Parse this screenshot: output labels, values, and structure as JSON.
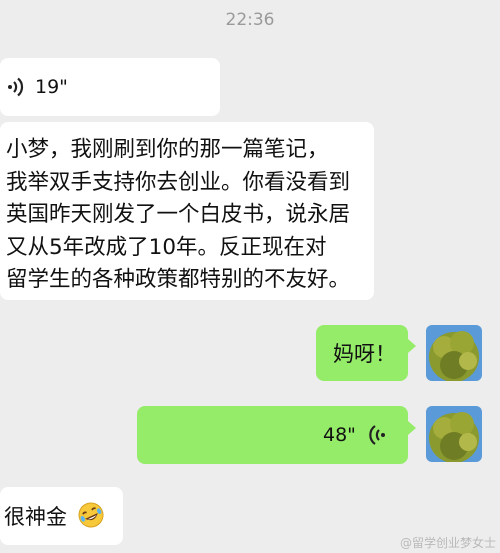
{
  "timestamp": "22:36",
  "messages": {
    "voice_in_duration": "19\"",
    "text_in_lines": "小梦，我刚刷到你的那一篇笔记，\n我举双手支持你去创业。你看没看到\n英国昨天刚发了一个白皮书，说永居\n又从5年改成了10年。反正现在对\n留学生的各种政策都特别的不友好。",
    "text_out": "妈呀！",
    "voice_out_duration": "48\"",
    "text_in_short": "很神金"
  },
  "icons": {
    "voice_wave": "voice-wave-icon",
    "emoji": "rolling-laughing-emoji-icon",
    "avatar": "tree-photo-avatar"
  },
  "watermark": "@留学创业梦女士",
  "colors": {
    "background": "#ededed",
    "incoming_bubble": "#ffffff",
    "outgoing_bubble": "#95ec69"
  }
}
